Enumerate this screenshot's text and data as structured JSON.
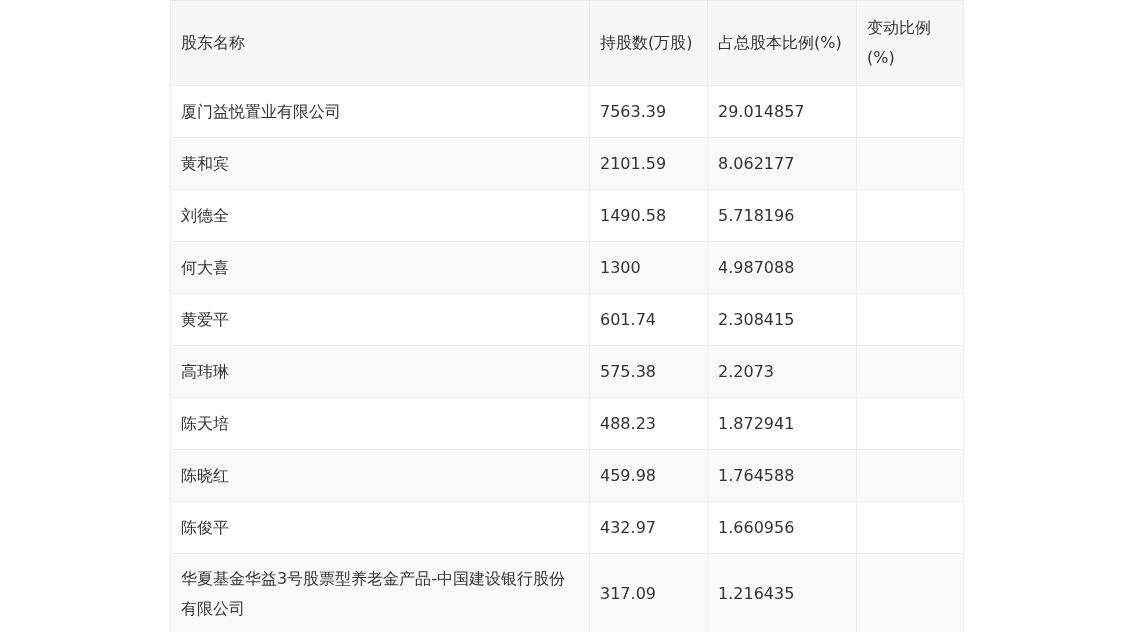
{
  "table": {
    "columns": [
      "股东名称",
      "持股数(万股)",
      "占总股本比例(%)",
      "变动比例(%)"
    ],
    "rows": [
      {
        "name": "厦门益悦置业有限公司",
        "shares": "7563.39",
        "ratio": "29.014857"
      },
      {
        "name": "黄和宾",
        "shares": "2101.59",
        "ratio": "8.062177"
      },
      {
        "name": "刘德全",
        "shares": "1490.58",
        "ratio": "5.718196"
      },
      {
        "name": "何大喜",
        "shares": "1300",
        "ratio": "4.987088"
      },
      {
        "name": "黄爱平",
        "shares": "601.74",
        "ratio": "2.308415"
      },
      {
        "name": "高玮琳",
        "shares": "575.38",
        "ratio": "2.2073"
      },
      {
        "name": "陈天培",
        "shares": "488.23",
        "ratio": "1.872941"
      },
      {
        "name": "陈晓红",
        "shares": "459.98",
        "ratio": "1.764588"
      },
      {
        "name": "陈俊平",
        "shares": "432.97",
        "ratio": "1.660956"
      },
      {
        "name": "华夏基金华益3号股票型养老金产品-中国建设银行股份有限公司",
        "shares": "317.09",
        "ratio": "1.216435"
      }
    ]
  }
}
